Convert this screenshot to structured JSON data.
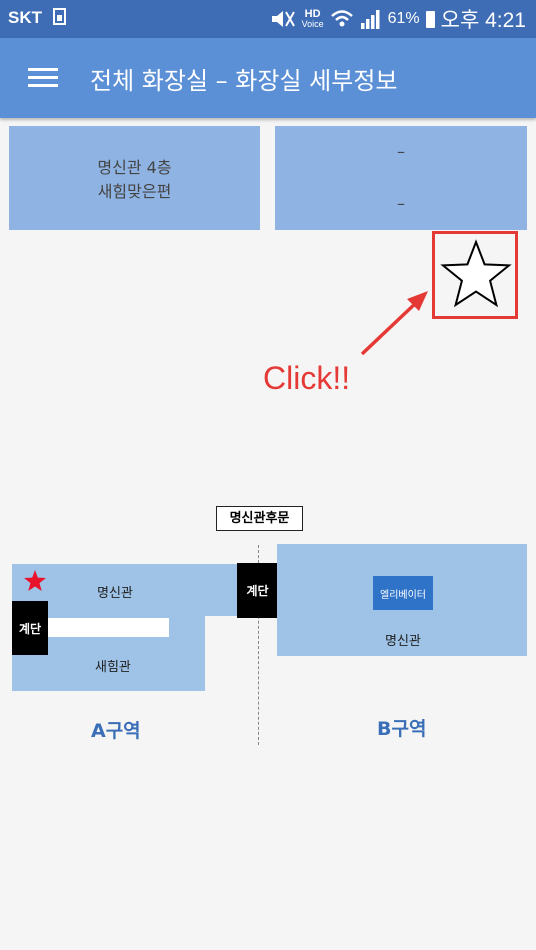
{
  "status_bar": {
    "carrier": "SKT",
    "hd_label": "HD",
    "voice_label": "Voice",
    "battery": "61%",
    "time": "오후 4:21"
  },
  "app_bar": {
    "title": "전체 화장실 – 화장실 세부정보",
    "menu_icon": "hamburger-menu-icon"
  },
  "info_cards": {
    "location_line1": "명신관 4층",
    "location_line2": "새힘맞은편",
    "detail_line1": "–",
    "detail_line2": "–"
  },
  "favorite": {
    "icon": "star-outline-icon"
  },
  "annotation": {
    "click_text": "Click!!",
    "color": "#e53935"
  },
  "map": {
    "gate_label": "명신관후문",
    "zone_a": {
      "building_main": "명신관",
      "building_sub": "새힘관",
      "stairs_left": "계단",
      "stairs_mid": "계단",
      "zone_label": "A구역"
    },
    "zone_b": {
      "elevator": "엘리베이터",
      "building": "명신관",
      "zone_label": "B구역"
    },
    "marker_icon": "red-star-icon"
  },
  "colors": {
    "status_bar": "#3e6db5",
    "app_bar": "#5b8fd6",
    "card": "#8fb4e3",
    "map_block": "#9ec3e6",
    "zone_text": "#3a6fb7"
  }
}
